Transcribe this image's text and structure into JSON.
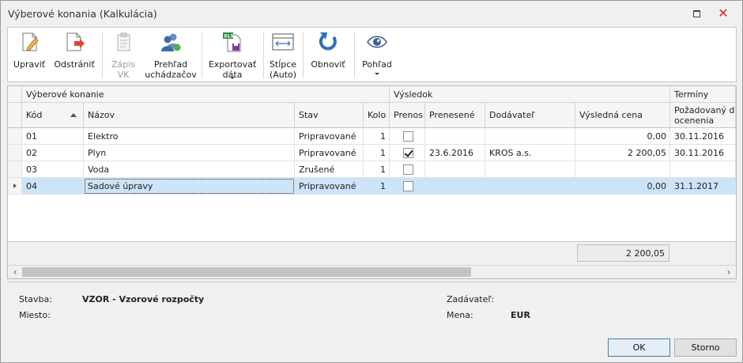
{
  "window": {
    "title": "Výberové konania (Kalkulácia)",
    "maximize_icon": "maximize-icon",
    "close_icon": "close-icon",
    "close_color": "#d9232c"
  },
  "toolbar": [
    {
      "key": "upravit",
      "label": "Upraviť",
      "icon": "pencil-document-icon",
      "disabled": false
    },
    {
      "key": "odstranit",
      "label": "Odstrániť",
      "icon": "delete-document-icon",
      "disabled": false
    },
    {
      "key": "zapis",
      "label": "Zápis\nVK",
      "icon": "clipboard-icon",
      "disabled": true
    },
    {
      "key": "prehlad",
      "label": "Prehľad\nuchádzačov",
      "icon": "users-icon",
      "disabled": false
    },
    {
      "key": "export",
      "label": "Exportovať\ndáta",
      "icon": "export-xls-icon",
      "disabled": false,
      "dropdown": true
    },
    {
      "key": "stlpce",
      "label": "Stĺpce\n(Auto)",
      "icon": "column-width-icon",
      "disabled": false
    },
    {
      "key": "obnovit",
      "label": "Obnoviť",
      "icon": "refresh-icon",
      "disabled": false
    },
    {
      "key": "pohlad",
      "label": "Pohľad",
      "icon": "eye-icon",
      "disabled": false,
      "dropdown": true
    }
  ],
  "grid": {
    "groups": [
      "Výberové konanie",
      "Výsledok",
      "Termíny"
    ],
    "columns": [
      "Kód",
      "Názov",
      "Stav",
      "Kolo",
      "Prenos",
      "Prenesené",
      "Dodávateľ",
      "Výsledná cena",
      "Požadovaný dát\nocenenia"
    ],
    "rows": [
      {
        "kod": "01",
        "nazov": "Elektro",
        "stav": "Pripravované",
        "kolo": "1",
        "prenos": false,
        "prenesene": "",
        "dodavatel": "",
        "cena": "0,00",
        "termin": "30.11.2016"
      },
      {
        "kod": "02",
        "nazov": "Plyn",
        "stav": "Pripravované",
        "kolo": "1",
        "prenos": true,
        "prenesene": "23.6.2016",
        "dodavatel": "KROS a.s.",
        "cena": "2 200,05",
        "termin": "30.11.2016"
      },
      {
        "kod": "03",
        "nazov": "Voda",
        "stav": "Zrušené",
        "kolo": "1",
        "prenos": false,
        "prenesene": "",
        "dodavatel": "",
        "cena": "",
        "termin": ""
      },
      {
        "kod": "04",
        "nazov": "Sadové úpravy",
        "stav": "Pripravované",
        "kolo": "1",
        "prenos": false,
        "prenesene": "",
        "dodavatel": "",
        "cena": "0,00",
        "termin": "31.1.2017"
      }
    ],
    "selected_row": 3,
    "sum": "2 200,05",
    "selection_color": "#cde3f7"
  },
  "info": {
    "stavba_label": "Stavba:",
    "stavba_value": "VZOR - Vzorové rozpočty",
    "miesto_label": "Miesto:",
    "miesto_value": "",
    "zadavatel_label": "Zadávateľ:",
    "zadavatel_value": "",
    "mena_label": "Mena:",
    "mena_value": "EUR"
  },
  "buttons": {
    "ok": "OK",
    "cancel": "Storno"
  }
}
